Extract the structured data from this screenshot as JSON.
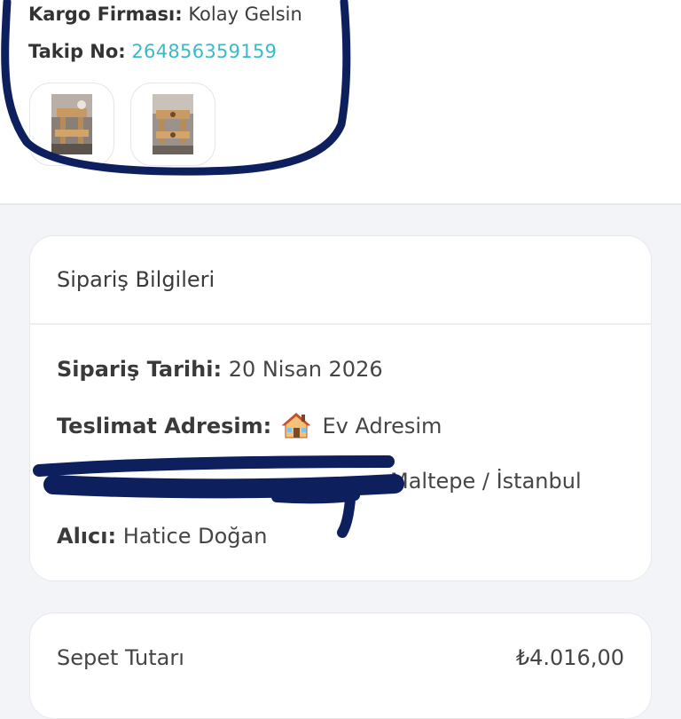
{
  "shipment": {
    "carrier_label": "Kargo Firması:",
    "carrier_value": "Kolay Gelsin",
    "tracking_label": "Takip No:",
    "tracking_value": "264856359159",
    "tracking_color": "#3bb8c9"
  },
  "products": [
    {
      "name": "product-thumbnail-1"
    },
    {
      "name": "product-thumbnail-2"
    }
  ],
  "order_info": {
    "title": "Sipariş Bilgileri",
    "date_label": "Sipariş Tarihi:",
    "date_value": "20 Nisan 2026",
    "address_label": "Teslimat Adresim:",
    "address_icon": "house-icon",
    "address_name": "Ev Adresim",
    "address_line_visible": "Maltepe / İstanbul",
    "recipient_label": "Alıcı:",
    "recipient_value": "Hatice Doğan"
  },
  "summary": {
    "basket_label": "Sepet Tutarı",
    "basket_value": "₺4.016,00"
  },
  "colors": {
    "annotation_ink": "#0d1f5c",
    "card_border": "#e7e8ed",
    "background": "#f3f4f7"
  }
}
